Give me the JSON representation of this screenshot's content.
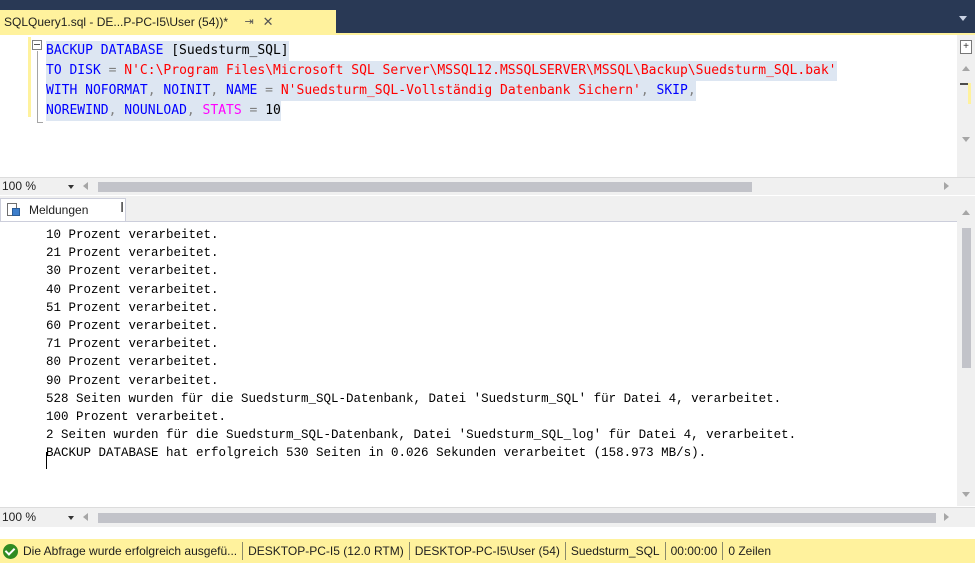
{
  "document_tab": {
    "title": "SQLQuery1.sql - DE...P-PC-I5\\User (54))*",
    "pin_glyph": "⇥",
    "close_glyph": "✕"
  },
  "editor": {
    "line1": {
      "kw": "BACKUP DATABASE",
      "name": " [Suedsturm_SQL]"
    },
    "line2": {
      "kw1": "TO DISK",
      "eq": " = ",
      "str": "N'C:\\Program Files\\Microsoft SQL Server\\MSSQL12.MSSQLSERVER\\MSSQL\\Backup\\Suedsturm_SQL.bak'"
    },
    "line3": {
      "kw1": "WITH",
      "o1": " NOFORMAT",
      "c1": ",",
      "o2": " NOINIT",
      "c2": ",",
      "o3": " NAME",
      "eq": " = ",
      "str": "N'Suedsturm_SQL-Vollständig Datenbank Sichern'",
      "c3": ",",
      "o4": " SKIP",
      "c4": ","
    },
    "line4": {
      "o1": "NOREWIND",
      "c1": ",",
      "o2": " NOUNLOAD",
      "c2": ",",
      "o3": " STATS",
      "eq": " = ",
      "num": "10"
    }
  },
  "zoom_top": "100 %",
  "messages_tab": {
    "label": "Meldungen"
  },
  "messages": [
    "10 Prozent verarbeitet.",
    "21 Prozent verarbeitet.",
    "30 Prozent verarbeitet.",
    "40 Prozent verarbeitet.",
    "51 Prozent verarbeitet.",
    "60 Prozent verarbeitet.",
    "71 Prozent verarbeitet.",
    "80 Prozent verarbeitet.",
    "90 Prozent verarbeitet.",
    "528 Seiten wurden für die Suedsturm_SQL-Datenbank, Datei 'Suedsturm_SQL' für Datei 4, verarbeitet.",
    "100 Prozent verarbeitet.",
    "2 Seiten wurden für die Suedsturm_SQL-Datenbank, Datei 'Suedsturm_SQL_log' für Datei 4, verarbeitet.",
    "BACKUP DATABASE hat erfolgreich 530 Seiten in 0.026 Sekunden verarbeitet (158.973 MB/s)."
  ],
  "zoom_bottom": "100 %",
  "status": {
    "message": "Die Abfrage wurde erfolgreich ausgefü...",
    "server": "DESKTOP-PC-I5 (12.0 RTM)",
    "user": "DESKTOP-PC-I5\\User (54)",
    "database": "Suedsturm_SQL",
    "elapsed": "00:00:00",
    "rows": "0 Zeilen"
  },
  "colors": {
    "accent_yellow": "#fff29d",
    "titlebar_dark": "#293955",
    "keyword_blue": "#0000ff",
    "string_red": "#ff0000",
    "option_magenta": "#ff00ff"
  }
}
